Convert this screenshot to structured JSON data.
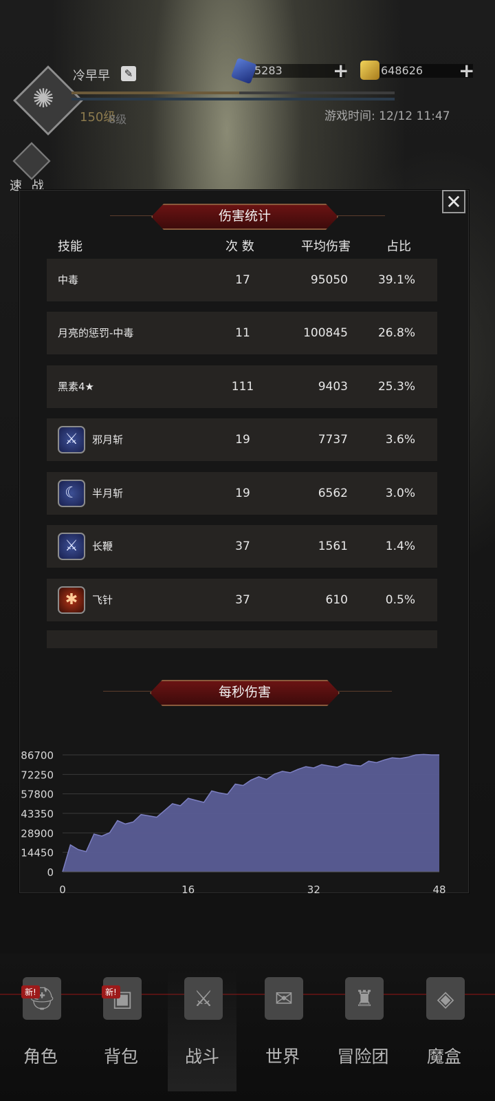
{
  "player": {
    "name": "冷早早",
    "level": "150级",
    "sub_level": "8级",
    "gems": "5283",
    "gold": "648626",
    "plus": "+",
    "game_time": "游戏时间: 12/12 11:47"
  },
  "quick_battle": "速 战",
  "close_label": "✕",
  "damage_stats": {
    "title": "伤害统计",
    "headers": {
      "skill": "技能",
      "count": "次 数",
      "avg": "平均伤害",
      "ratio": "占比"
    },
    "rows": [
      {
        "name": "中毒",
        "count": "17",
        "avg": "95050",
        "ratio": "39.1%"
      },
      {
        "name": "月亮的惩罚-中毒",
        "count": "11",
        "avg": "100845",
        "ratio": "26.8%"
      },
      {
        "name": "黑素4★",
        "count": "111",
        "avg": "9403",
        "ratio": "25.3%"
      },
      {
        "name": "邪月斩",
        "count": "19",
        "avg": "7737",
        "ratio": "3.6%",
        "icon": "sword-icon"
      },
      {
        "name": "半月斩",
        "count": "19",
        "avg": "6562",
        "ratio": "3.0%",
        "icon": "crescent-moon-icon"
      },
      {
        "name": "长鞭",
        "count": "37",
        "avg": "1561",
        "ratio": "1.4%",
        "icon": "sword-icon"
      },
      {
        "name": "飞针",
        "count": "37",
        "avg": "610",
        "ratio": "0.5%",
        "icon": "spider-icon"
      }
    ]
  },
  "dps": {
    "title": "每秒伤害"
  },
  "chart_data": {
    "type": "area",
    "title": "每秒伤害",
    "xlabel": "",
    "ylabel": "",
    "xlim": [
      0,
      48
    ],
    "ylim": [
      0,
      86700
    ],
    "x_ticks": [
      "0",
      "16",
      "32",
      "48"
    ],
    "y_ticks": [
      "86700",
      "72250",
      "57800",
      "43350",
      "28900",
      "14450",
      "0"
    ],
    "grid": true,
    "fill_color": "#5a5d96",
    "x": [
      0,
      1,
      2,
      3,
      4,
      5,
      6,
      7,
      8,
      9,
      10,
      11,
      12,
      13,
      14,
      15,
      16,
      17,
      18,
      19,
      20,
      21,
      22,
      23,
      24,
      25,
      26,
      27,
      28,
      29,
      30,
      31,
      32,
      33,
      34,
      35,
      36,
      37,
      38,
      39,
      40,
      41,
      42,
      43,
      44,
      45,
      46,
      47,
      48
    ],
    "values": [
      0,
      20000,
      16500,
      15000,
      28000,
      26500,
      29000,
      38000,
      35500,
      37000,
      42500,
      41500,
      40500,
      45500,
      50500,
      49000,
      54500,
      53000,
      51500,
      60000,
      58500,
      57500,
      65000,
      64000,
      68000,
      70500,
      68500,
      72500,
      74500,
      73500,
      76000,
      78000,
      77000,
      79500,
      78500,
      77500,
      80000,
      79000,
      78500,
      82000,
      81000,
      83000,
      84500,
      84000,
      85000,
      86700,
      87000,
      86700,
      86700
    ]
  },
  "nav": [
    {
      "label": "角色",
      "icon": "helmet-icon",
      "badge": "新!"
    },
    {
      "label": "背包",
      "icon": "backpack-icon",
      "badge": "新!"
    },
    {
      "label": "战斗",
      "icon": "shield-sword-icon",
      "badge": ""
    },
    {
      "label": "世界",
      "icon": "map-scroll-icon",
      "badge": ""
    },
    {
      "label": "冒险团",
      "icon": "castle-icon",
      "badge": ""
    },
    {
      "label": "魔盒",
      "icon": "cube-icon",
      "badge": ""
    }
  ],
  "colors": {
    "banner": "#6a1313",
    "row_bg": "#262422",
    "chart_fill": "#5a5d96"
  }
}
